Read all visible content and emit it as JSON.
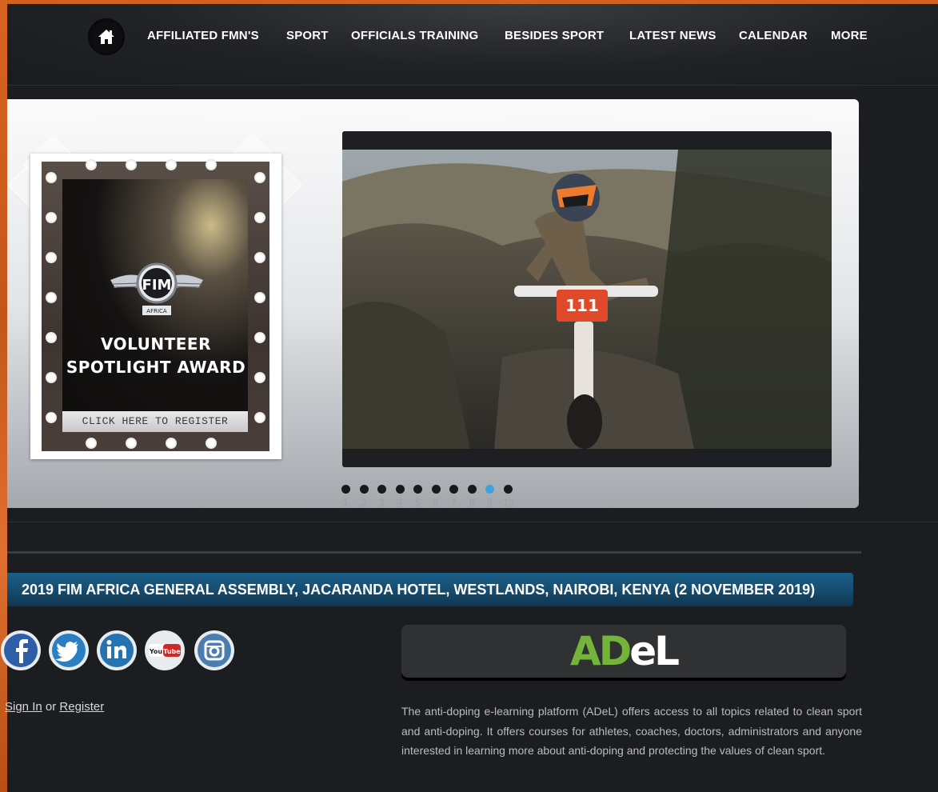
{
  "nav": {
    "items": [
      {
        "label": "AFFILIATED FMN'S"
      },
      {
        "label": "SPORT"
      },
      {
        "label": "OFFICIALS TRAINING"
      },
      {
        "label": "BESIDES SPORT"
      },
      {
        "label": "LATEST NEWS"
      },
      {
        "label": "CALENDAR"
      },
      {
        "label": "MORE"
      }
    ]
  },
  "poster": {
    "logo_text": "FIM",
    "logo_subtext": "AFRICA",
    "title_line1": "VOLUNTEER",
    "title_line2": "SPOTLIGHT AWARD",
    "button_label": "CLICK HERE TO REGISTER"
  },
  "slider": {
    "pages": [
      "1",
      "2",
      "3",
      "4",
      "5",
      "6",
      "7",
      "8",
      "9",
      "10"
    ],
    "active_index": 8,
    "bike_number": "111"
  },
  "headline": "2019 FIM AFRICA GENERAL ASSEMBLY, JACARANDA HOTEL, WESTLANDS, NAIROBI, KENYA (2 NOVEMBER 2019)",
  "social": {
    "youtube_label": "You Tube"
  },
  "adel": {
    "logo_ad": "AD",
    "logo_el": "eL",
    "description": "The anti-doping e-learning platform (ADeL) offers access to all topics related to clean sport and anti-doping. It offers courses for athletes, coaches, doctors, administrators and anyone interested in learning more about anti-doping and protecting the values of clean sport."
  },
  "account": {
    "sign_in": "Sign In",
    "or": "or",
    "register": "Register"
  },
  "colors": {
    "accent_orange": "#d2601e",
    "headline_blue": "#1a5f8a",
    "active_dot": "#3fa2df",
    "adel_green": "#75b43a"
  }
}
